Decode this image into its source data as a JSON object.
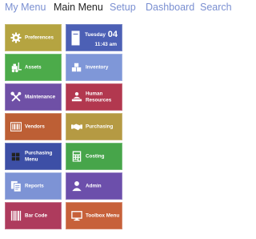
{
  "nav": {
    "items": [
      {
        "label": "My Menu",
        "active": false
      },
      {
        "label": "Main Menu",
        "active": true
      },
      {
        "label": "Setup",
        "active": false
      },
      {
        "label": "Dashboard",
        "active": false
      },
      {
        "label": "Search",
        "active": false
      }
    ]
  },
  "colors": {
    "nav_link": "#7a8fd1",
    "nav_active": "#222222",
    "olive": "#b5a441",
    "blue": "#4c60b5",
    "green": "#4cab4a",
    "periwinkle": "#7f97d8",
    "purple": "#6f50a6",
    "crimson": "#b2384f",
    "rust": "#bd5f35",
    "gold": "#b59a43",
    "indigo": "#3d4fa6",
    "emerald": "#47a54a",
    "lightblue": "#7d93d5",
    "violet": "#6c4fab",
    "magenta": "#ae3b5d",
    "orange": "#c7613a"
  },
  "tiles": [
    {
      "label": "Preferences",
      "icon": "gear-icon"
    },
    {
      "date_day": "Tuesday",
      "date_num": "04",
      "time": "11:43 am",
      "icon": "calendar-icon"
    },
    {
      "label": "Assets",
      "icon": "forklift-icon"
    },
    {
      "label": "Inventory",
      "icon": "boxes-icon"
    },
    {
      "label": "Maintenance",
      "icon": "tools-icon"
    },
    {
      "label": "Human\nResources",
      "icon": "people-icon"
    },
    {
      "label": "Vendors",
      "icon": "barcode-vendor-icon"
    },
    {
      "label": "Purchasing",
      "icon": "handshake-icon"
    },
    {
      "label": "Purchasing\nMenu",
      "icon": "grid-icon"
    },
    {
      "label": "Costing",
      "icon": "calculator-icon"
    },
    {
      "label": "Reports",
      "icon": "documents-icon"
    },
    {
      "label": "Admin",
      "icon": "admin-user-icon"
    },
    {
      "label": "Bar Code",
      "icon": "barcode-icon"
    },
    {
      "label": "Toolbox Menu",
      "icon": "monitor-icon"
    }
  ]
}
